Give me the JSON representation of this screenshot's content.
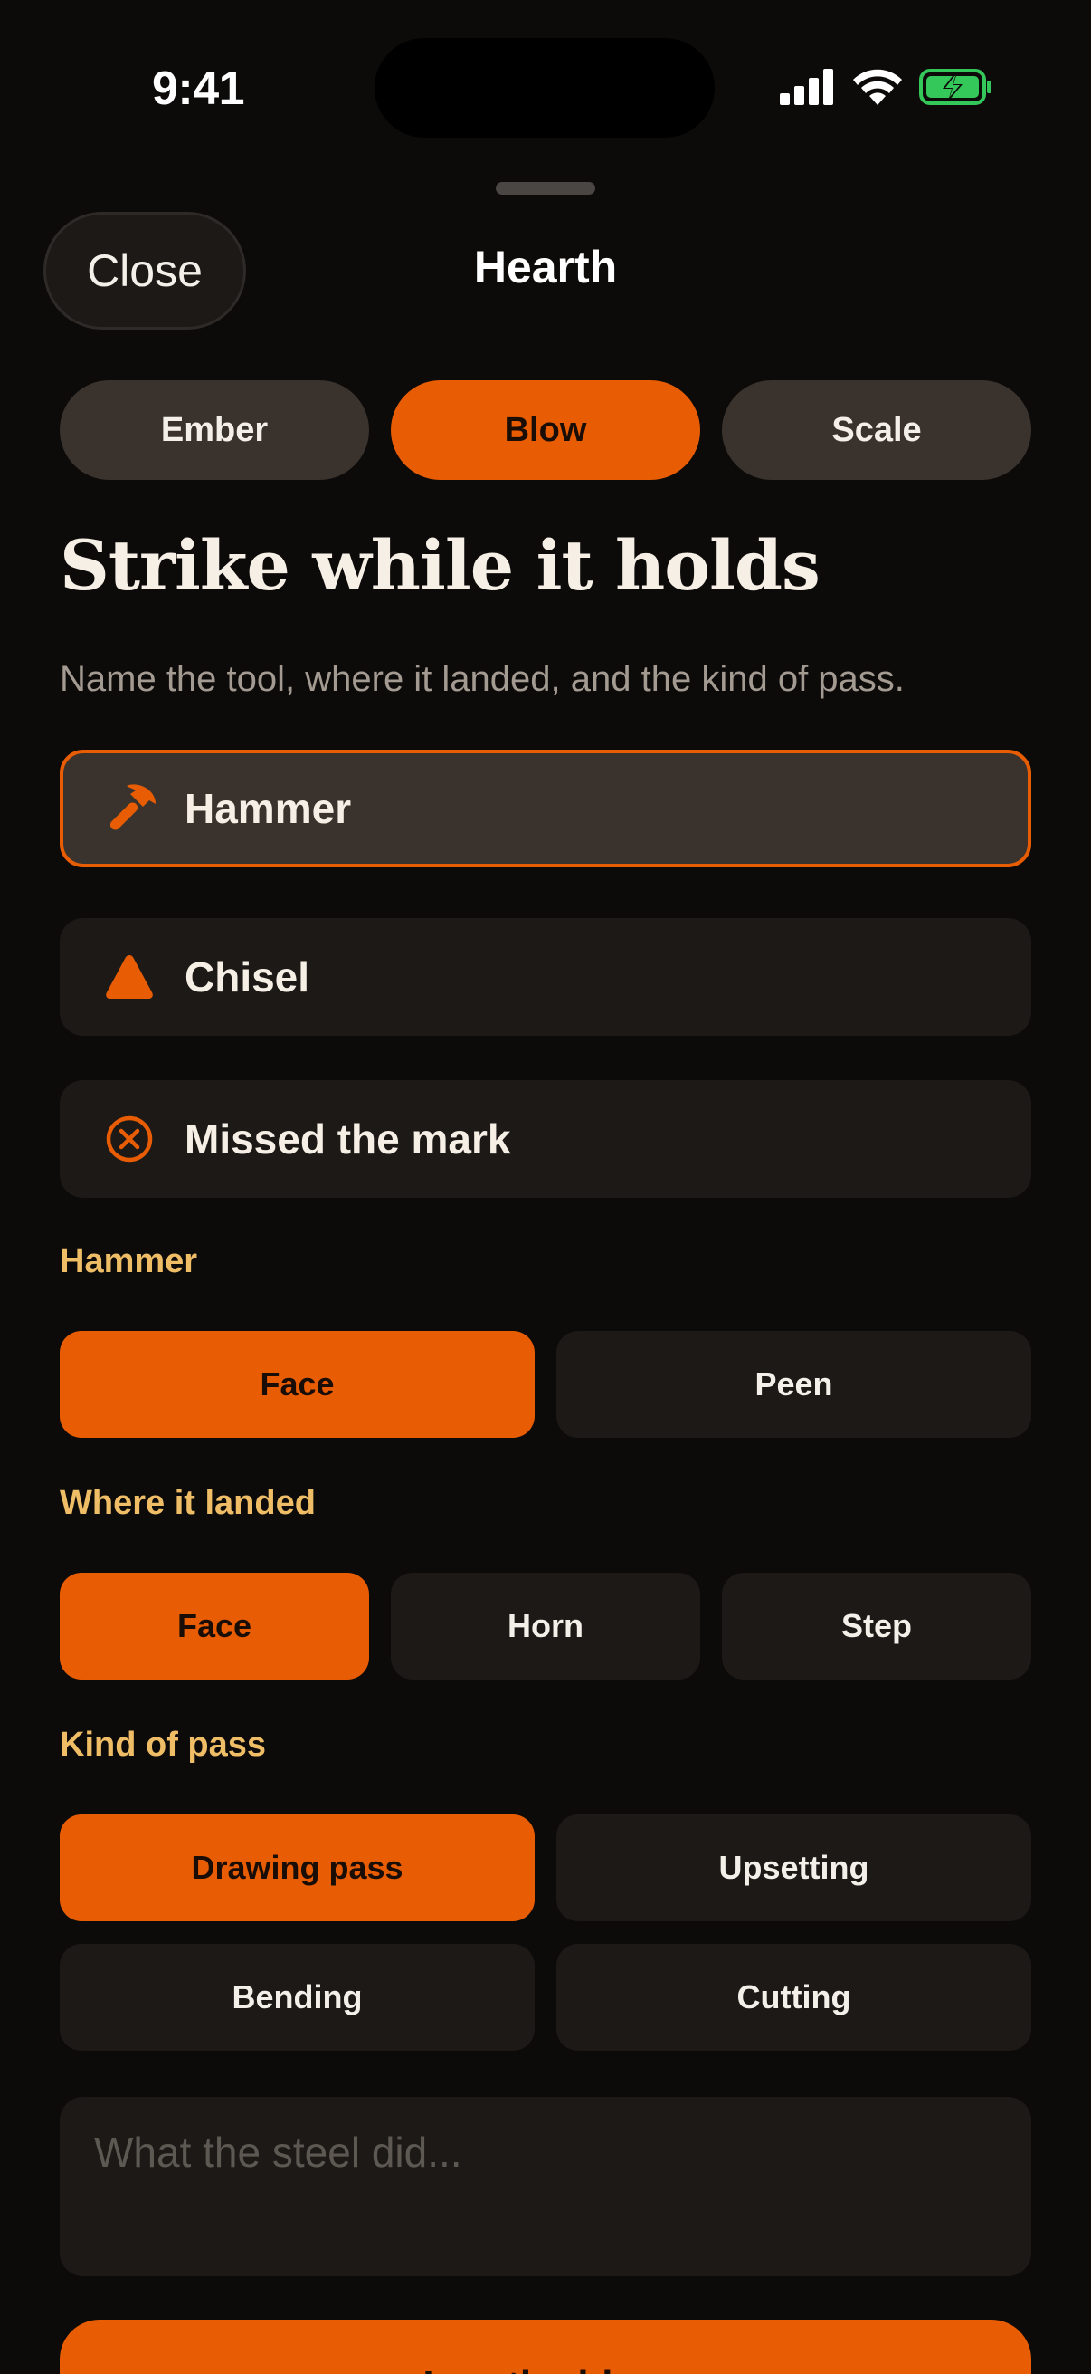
{
  "status_bar": {
    "time": "9:41"
  },
  "sheet": {
    "close_label": "Close",
    "title": "Hearth"
  },
  "tabs": [
    {
      "label": "Ember",
      "active": false
    },
    {
      "label": "Blow",
      "active": true
    },
    {
      "label": "Scale",
      "active": false
    }
  ],
  "heading": "Strike while it holds",
  "subtitle": "Name the tool, where it landed, and the kind of pass.",
  "tools": [
    {
      "label": "Hammer",
      "icon": "hammer-icon",
      "selected": true
    },
    {
      "label": "Chisel",
      "icon": "triangle-icon",
      "selected": false
    },
    {
      "label": "Missed the mark",
      "icon": "x-circle-icon",
      "selected": false
    }
  ],
  "hammer_section": {
    "label": "Hammer",
    "options": [
      {
        "label": "Face",
        "active": true
      },
      {
        "label": "Peen",
        "active": false
      }
    ]
  },
  "landed_section": {
    "label": "Where it landed",
    "options": [
      {
        "label": "Face",
        "active": true
      },
      {
        "label": "Horn",
        "active": false
      },
      {
        "label": "Step",
        "active": false
      }
    ]
  },
  "pass_section": {
    "label": "Kind of pass",
    "options": [
      {
        "label": "Drawing pass",
        "active": true
      },
      {
        "label": "Upsetting",
        "active": false
      },
      {
        "label": "Bending",
        "active": false
      },
      {
        "label": "Cutting",
        "active": false
      }
    ]
  },
  "notes": {
    "value": "",
    "placeholder": "What the steel did..."
  },
  "primary_button": {
    "label": "Log the blow"
  },
  "colors": {
    "accent": "#e85d04",
    "section_label": "#efbd66",
    "background": "#0d0b0a",
    "battery": "#34c759"
  }
}
